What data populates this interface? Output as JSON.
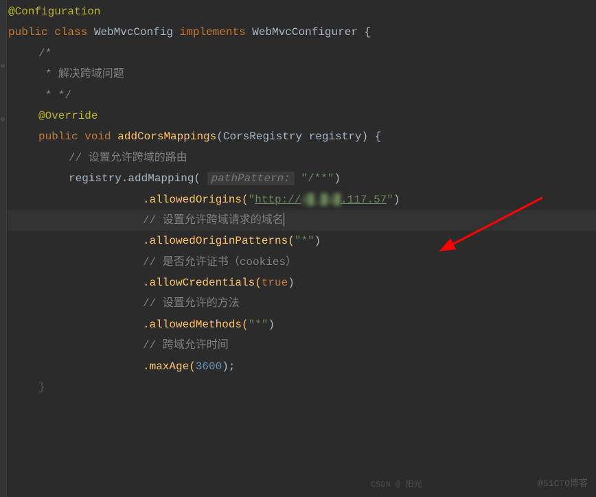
{
  "code": {
    "annotation_config": "@Configuration",
    "kw_public": "public",
    "kw_class": "class",
    "class_name": "WebMvcConfig",
    "kw_implements": "implements",
    "interface_name": "WebMvcConfigurer",
    "brace_open": "{",
    "brace_close": "}",
    "comment_block_start": "/*",
    "comment_block_line1": " * 解决跨域问题",
    "comment_block_end": " * */",
    "annotation_override": "@Override",
    "kw_void": "void",
    "method_name": "addCorsMappings",
    "param_type": "CorsRegistry",
    "param_name": "registry",
    "comment_route": "// 设置允许跨域的路由",
    "call_addmap": "registry.addMapping(",
    "hint_pathpattern": "pathPattern:",
    "str_pathpattern": "\"/**\"",
    "paren_close": ")",
    "call_allowedorigins": ".allowedOrigins(",
    "str_url_q1": "\"",
    "str_url_proto": "http://",
    "str_url_blur": "4█.█a█",
    "str_url_tail": ".117.57",
    "str_url_q2": "\"",
    "comment_domain": "// 设置允许跨域请求的域名",
    "call_allowedoriginpatterns": ".allowedOriginPatterns(",
    "str_star": "\"*\"",
    "comment_cookies": "// 是否允许证书（cookies）",
    "call_allowcredentials": ".allowCredentials(",
    "val_true": "true",
    "comment_methods": "// 设置允许的方法",
    "call_allowedmethods": ".allowedMethods(",
    "comment_maxage": "// 跨域允许时间",
    "call_maxage": ".maxAge(",
    "val_3600": "3600",
    "semi": ";"
  },
  "watermarks": {
    "right": "@51CTO博客",
    "left": "CSDN @ 阳光"
  }
}
